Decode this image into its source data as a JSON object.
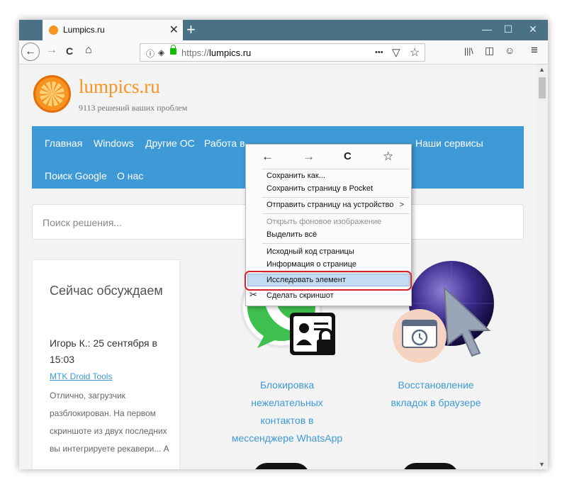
{
  "tab": {
    "title": "Lumpics.ru",
    "close": "✕"
  },
  "new_tab": "+",
  "window_controls": {
    "minimize": "—",
    "maximize": "☐",
    "close": "✕"
  },
  "nav": {
    "back": "←",
    "forward": "→",
    "reload": "C",
    "home": "⌂",
    "url_protocol": "https://",
    "url_host": "lumpics.ru",
    "more": "•••",
    "pocket": "▽",
    "bookmark": "☆",
    "library": "|||\\",
    "sidebar": "◫",
    "account": "☺",
    "menu": "≡"
  },
  "site": {
    "logo_title": "lumpics.ru",
    "logo_subtitle": "9113 решений ваших проблем",
    "menu_row1": [
      "Главная",
      "Windows",
      "Другие ОС",
      "Работа в",
      "Наши сервисы"
    ],
    "menu_row2": [
      "Поиск Google",
      "О нас"
    ],
    "search_placeholder": "Поиск решения...",
    "sidebar": {
      "heading": "Сейчас обсуждаем",
      "author": "Игорь К.: 25 сентября в 15:03",
      "link": "MTK Droid Tools",
      "comment": "Отлично, загрузчик разблокирован. На первом скриншоте из двух последних вы интегрируете рекавери... А"
    },
    "card1_title": "Блокировка нежелательных контактов в мессенджере WhatsApp",
    "card2_title": "Восстановление вкладок в браузере"
  },
  "context_menu": {
    "nav": {
      "back": "←",
      "forward": "→",
      "reload": "C",
      "bookmark": "☆"
    },
    "items": [
      "Сохранить как...",
      "Сохранить страницу в Pocket",
      "Отправить страницу на устройство",
      "Открыть фоновое изображение",
      "Выделить всё",
      "Исходный код страницы",
      "Информация о странице",
      "Исследовать элемент",
      "Сделать скриншот"
    ],
    "submenu_arrow": ">"
  },
  "colors": {
    "accent": "#3d9ad6",
    "titlebar": "#4a7287",
    "logo": "#f7931e",
    "highlight_ring": "#d8222f"
  }
}
